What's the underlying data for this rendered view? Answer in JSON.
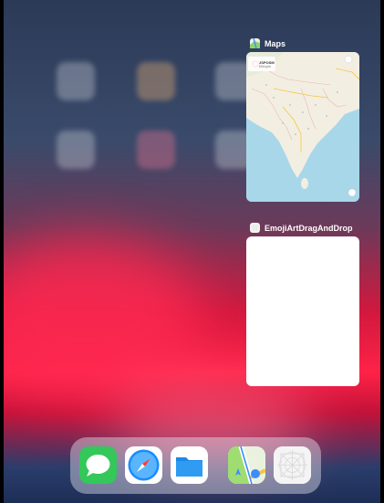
{
  "switcher": {
    "maps": {
      "title": "Maps",
      "icon": "maps-icon",
      "pin_label": "JSPOSM",
      "pin_sublabel": "Ethiopia"
    },
    "emoji": {
      "title": "EmojiArtDragAndDrop",
      "icon": "emoji-art-icon"
    }
  },
  "dock": {
    "items": [
      {
        "name": "messages",
        "icon": "messages-icon"
      },
      {
        "name": "safari",
        "icon": "safari-icon"
      },
      {
        "name": "files",
        "icon": "files-icon"
      },
      {
        "name": "maps",
        "icon": "maps-icon"
      },
      {
        "name": "emoji-art",
        "icon": "emoji-art-icon"
      }
    ]
  },
  "colors": {
    "wallpaper_red": "#ff2247",
    "wallpaper_blue": "#2b3a57",
    "maps_water": "#a9d7ea",
    "maps_land": "#f3eee2",
    "messages_green": "#34c759",
    "files_blue": "#1e88e5"
  }
}
